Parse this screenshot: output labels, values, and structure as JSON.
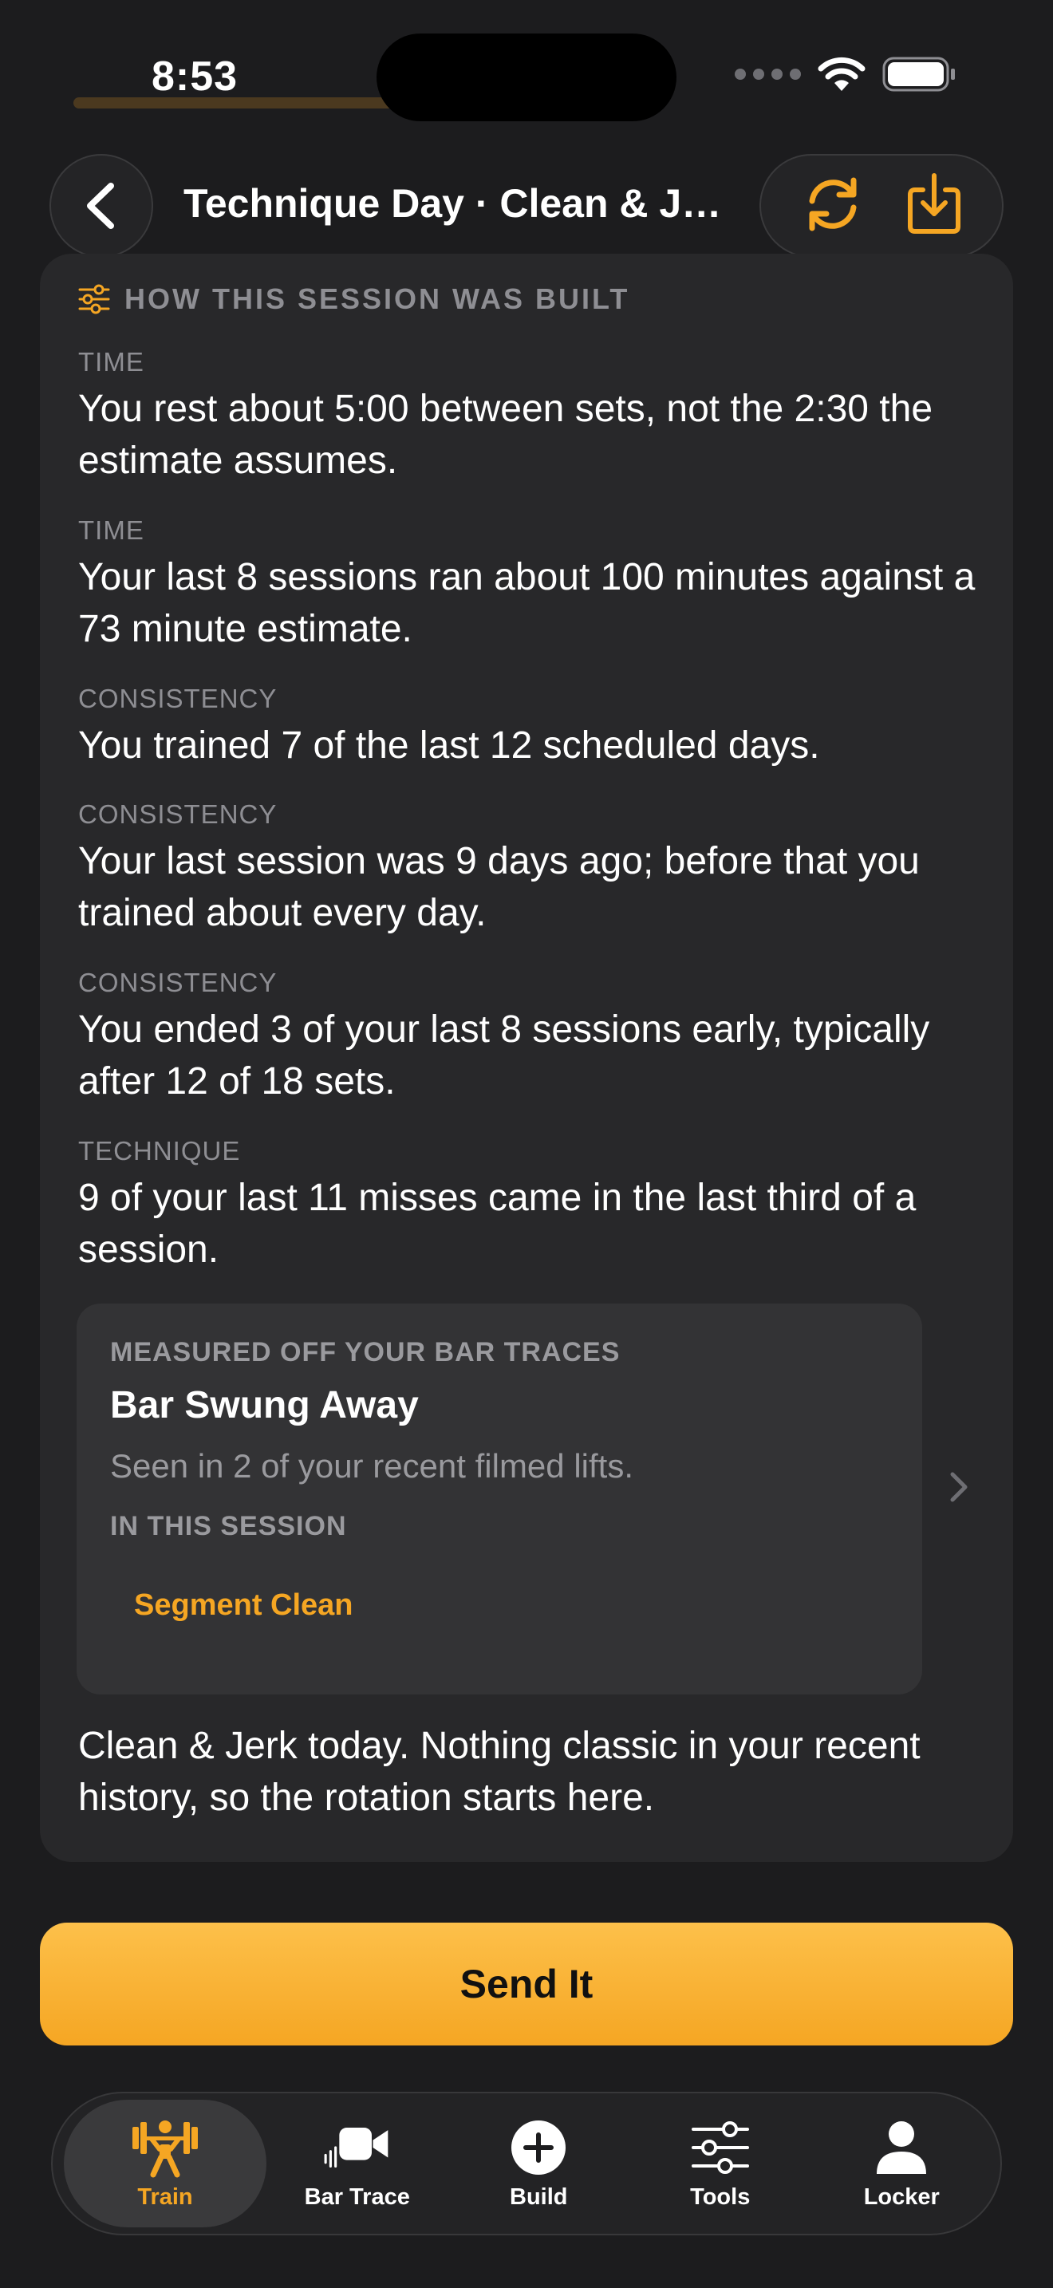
{
  "status_bar": {
    "time": "8:53"
  },
  "nav": {
    "title": "Technique Day · Clean & Je..."
  },
  "card": {
    "heading": "HOW THIS SESSION WAS BUILT",
    "items": [
      {
        "label": "TIME",
        "text": "You rest about 5:00 between sets, not the 2:30 the estimate assumes."
      },
      {
        "label": "TIME",
        "text": "Your last 8 sessions ran about 100 minutes against a 73 minute estimate."
      },
      {
        "label": "CONSISTENCY",
        "text": "You trained 7 of the last 12 scheduled days."
      },
      {
        "label": "CONSISTENCY",
        "text": "Your last session was 9 days ago; before that you trained about every day."
      },
      {
        "label": "CONSISTENCY",
        "text": "You ended 3 of your last 8 sessions early, typically after 12 of 18 sets."
      },
      {
        "label": "TECHNIQUE",
        "text": "9 of your last 11 misses came in the last third of a session."
      }
    ],
    "insight": {
      "label": "MEASURED OFF YOUR BAR TRACES",
      "title": "Bar Swung Away",
      "description": "Seen in 2 of your recent filmed lifts.",
      "session_label": "IN THIS SESSION",
      "chip": "Segment Clean"
    },
    "closing": "Clean & Jerk today. Nothing classic in your recent history, so the rotation starts here."
  },
  "cta": {
    "label": "Send It"
  },
  "tabs": [
    {
      "label": "Train",
      "icon": "weightlifter-icon",
      "active": true
    },
    {
      "label": "Bar Trace",
      "icon": "video-camera-icon",
      "active": false
    },
    {
      "label": "Build",
      "icon": "plus-circle-icon",
      "active": false
    },
    {
      "label": "Tools",
      "icon": "sliders-icon",
      "active": false
    },
    {
      "label": "Locker",
      "icon": "person-icon",
      "active": false
    }
  ],
  "colors": {
    "accent": "#f5a623",
    "background": "#1c1c1e",
    "card": "#28282a",
    "muted": "#8e8e93"
  }
}
